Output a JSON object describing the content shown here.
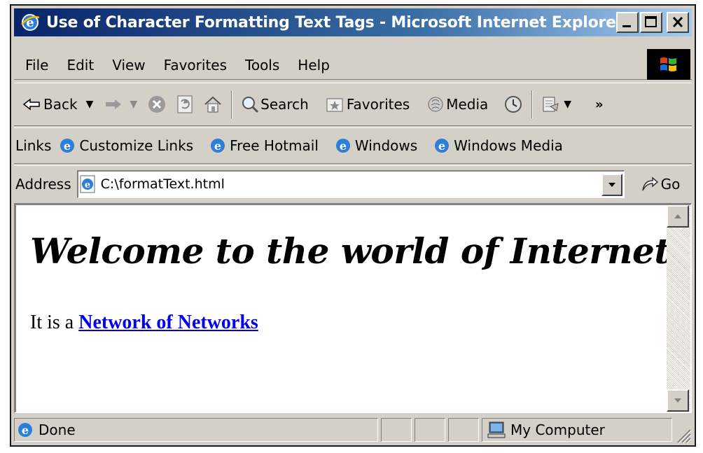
{
  "window": {
    "title": "Use of Character Formatting Text Tags - Microsoft Internet Explorer",
    "icon": "ie-icon",
    "controls": [
      "minimize",
      "maximize",
      "close"
    ]
  },
  "menubar": {
    "items": [
      "File",
      "Edit",
      "View",
      "Favorites",
      "Tools",
      "Help"
    ]
  },
  "toolbar": {
    "back_label": "Back",
    "search_label": "Search",
    "favorites_label": "Favorites",
    "media_label": "Media"
  },
  "links": {
    "label": "Links",
    "items": [
      "Customize Links",
      "Free Hotmail",
      "Windows",
      "Windows Media"
    ]
  },
  "address": {
    "label": "Address",
    "value": "C:\\formatText.html",
    "go_label": "Go"
  },
  "page": {
    "heading": "Welcome to the world of Internet",
    "text_prefix": "It is a",
    "link_text": "Network of Networks"
  },
  "status": {
    "text": "Done",
    "zone": "My Computer"
  },
  "colors": {
    "title_start": "#0a246a",
    "title_end": "#a6caf0",
    "chrome": "#d4d0c8",
    "link": "#0000ee"
  }
}
